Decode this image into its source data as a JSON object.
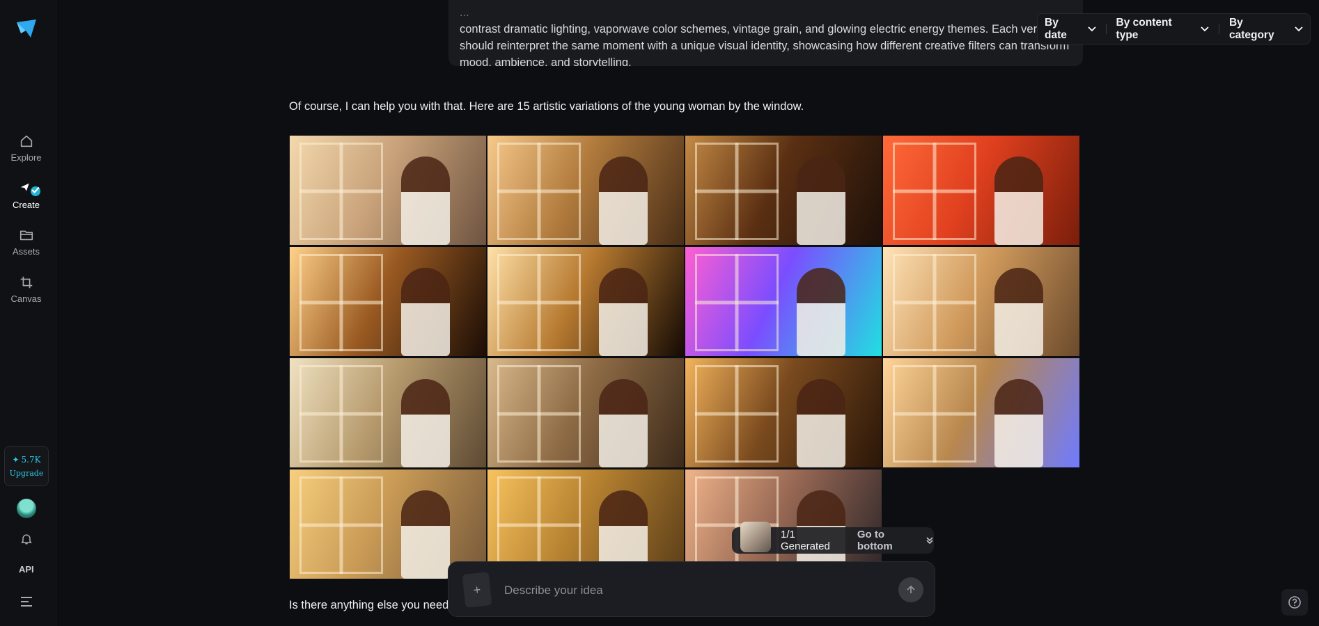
{
  "sidebar": {
    "items": [
      {
        "label": "Explore",
        "icon": "home-icon"
      },
      {
        "label": "Create",
        "icon": "create-icon"
      },
      {
        "label": "Assets",
        "icon": "folder-icon"
      },
      {
        "label": "Canvas",
        "icon": "crop-icon"
      }
    ],
    "credits": "5.7K",
    "upgrade_label": "Upgrade",
    "api_label": "API"
  },
  "prompt": {
    "line1_partial": "...",
    "line2": "contrast dramatic lighting, vaporwave color schemes, vintage grain, and glowing electric energy themes. Each version",
    "line3": "should reinterpret the same moment with a unique visual identity, showcasing how different creative filters can transform",
    "line4": "mood, ambience, and storytelling."
  },
  "filters": {
    "by_date": "By date",
    "by_content_type": "By content type",
    "by_category": "By category"
  },
  "reply_text": "Of course, I can help you with that. Here are 15 artistic variations of the young woman by the window.",
  "images": [
    {
      "style": "soft-haze",
      "colors": [
        "#f3d9ad",
        "#c9a27a",
        "#6e5440"
      ]
    },
    {
      "style": "golden-glow",
      "colors": [
        "#f6c98b",
        "#b07a3c",
        "#4a2e17"
      ]
    },
    {
      "style": "dark-warm",
      "colors": [
        "#c48a45",
        "#5a2f12",
        "#1e1009"
      ]
    },
    {
      "style": "red-wall",
      "colors": [
        "#ff6a3a",
        "#e0401e",
        "#7a1e0b"
      ]
    },
    {
      "style": "deep-shadow",
      "colors": [
        "#ffd28a",
        "#9a5a22",
        "#1b0d05"
      ]
    },
    {
      "style": "contrast",
      "colors": [
        "#ffe1a8",
        "#b5782f",
        "#140a04"
      ]
    },
    {
      "style": "vaporwave",
      "colors": [
        "#ff5fd1",
        "#7b4dff",
        "#20e0e0"
      ]
    },
    {
      "style": "glitch",
      "colors": [
        "#ffe3b8",
        "#d09a5c",
        "#6b4a2c"
      ]
    },
    {
      "style": "pastel-light",
      "colors": [
        "#efe2c2",
        "#b79b6e",
        "#5e4a33"
      ]
    },
    {
      "style": "vintage-grain",
      "colors": [
        "#d9b98c",
        "#8e6b45",
        "#3c2a1a"
      ]
    },
    {
      "style": "electric-warm",
      "colors": [
        "#f2b35c",
        "#7a4a1e",
        "#2a1608"
      ]
    },
    {
      "style": "electric-blue",
      "colors": [
        "#ffd59a",
        "#b7874e",
        "#6f7bff"
      ]
    },
    {
      "style": "painterly",
      "colors": [
        "#f7cf7e",
        "#c89a55",
        "#76583a"
      ]
    },
    {
      "style": "art-nouveau",
      "colors": [
        "#f8c35e",
        "#b88331",
        "#5a3d18"
      ]
    },
    {
      "style": "city-dusk",
      "colors": [
        "#f0b48a",
        "#9a6a55",
        "#2c2428"
      ]
    }
  ],
  "generated": {
    "count": "1/1",
    "label": "Generated",
    "goto": "Go to bottom"
  },
  "footer_text": "Is there anything else you need",
  "composer": {
    "placeholder": "Describe your idea"
  }
}
